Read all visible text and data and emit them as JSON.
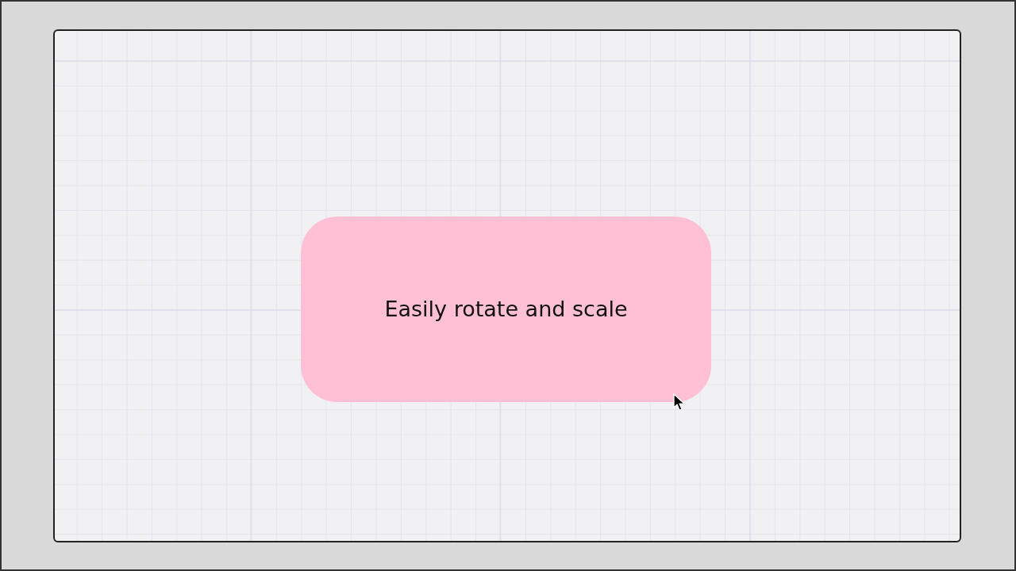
{
  "canvas": {
    "shapes": [
      {
        "kind": "rounded_rectangle",
        "label": "Easily rotate and scale"
      }
    ],
    "cursor": true
  }
}
